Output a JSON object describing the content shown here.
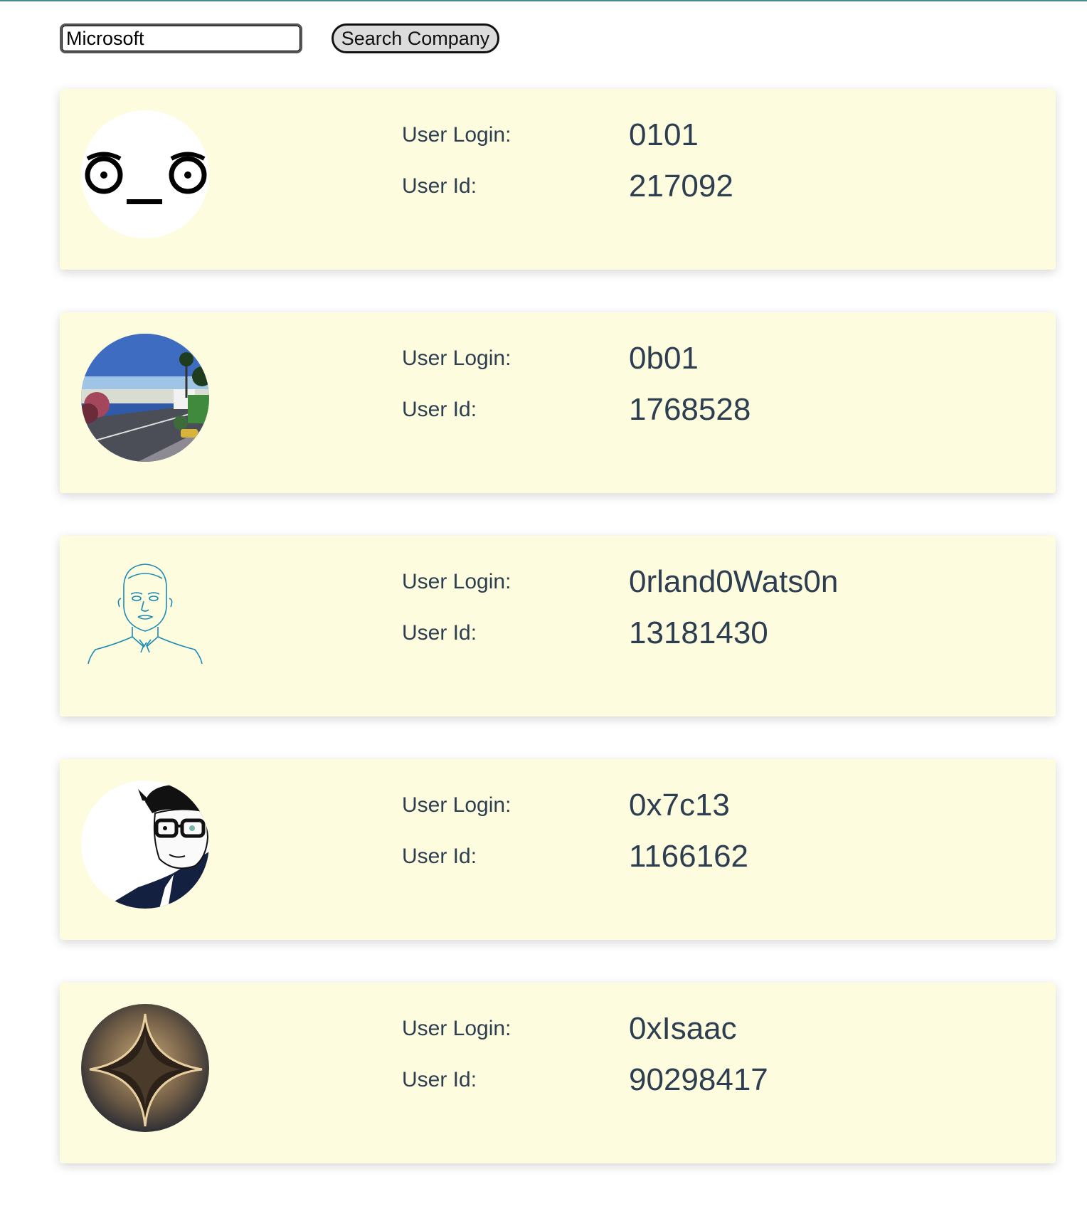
{
  "search": {
    "value": "Microsoft",
    "button_label": "Search Company"
  },
  "labels": {
    "login": "User Login:",
    "id": "User Id:"
  },
  "users": [
    {
      "login": "0101",
      "id": "217092",
      "avatar": "disapproval-face-avatar"
    },
    {
      "login": "0b01",
      "id": "1768528",
      "avatar": "beach-road-avatar"
    },
    {
      "login": "0rland0Wats0n",
      "id": "13181430",
      "avatar": "line-sketch-portrait-avatar"
    },
    {
      "login": "0x7c13",
      "id": "1166162",
      "avatar": "glasses-cartoon-avatar"
    },
    {
      "login": "0xIsaac",
      "id": "90298417",
      "avatar": "metal-star-emblem-avatar"
    }
  ]
}
